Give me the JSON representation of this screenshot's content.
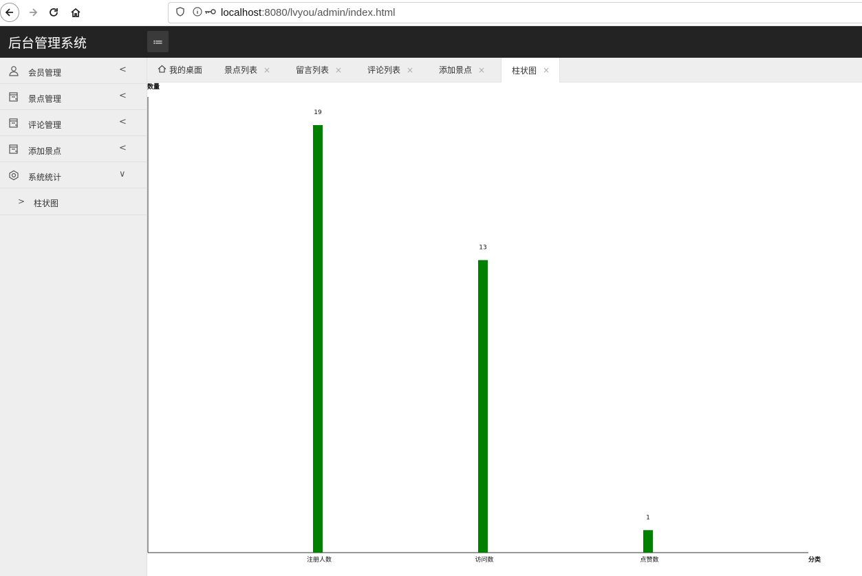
{
  "browser": {
    "url_host": "localhost",
    "url_rest": ":8080/lvyou/admin/index.html",
    "icons": [
      "back-icon",
      "forward-icon",
      "reload-icon",
      "home-icon",
      "shield-icon",
      "info-icon",
      "key-icon"
    ]
  },
  "header": {
    "title": "后台管理系统",
    "menu_icon": "≔"
  },
  "sidebar": {
    "items": [
      {
        "label": "会员管理",
        "icon": "user-icon",
        "arrow": "<"
      },
      {
        "label": "景点管理",
        "icon": "document-icon",
        "arrow": "<"
      },
      {
        "label": "评论管理",
        "icon": "document-icon",
        "arrow": "<"
      },
      {
        "label": "添加景点",
        "icon": "document-icon",
        "arrow": "<"
      },
      {
        "label": "系统统计",
        "icon": "stats-icon",
        "arrow": "∨"
      }
    ],
    "sub_items": [
      {
        "label": "柱状图",
        "arrow": ">"
      }
    ]
  },
  "tabs": [
    {
      "label": "我的桌面",
      "closable": false
    },
    {
      "label": "景点列表",
      "closable": true
    },
    {
      "label": "留言列表",
      "closable": true
    },
    {
      "label": "评论列表",
      "closable": true
    },
    {
      "label": "添加景点",
      "closable": true
    },
    {
      "label": "柱状图",
      "closable": true,
      "active": true
    }
  ],
  "tab_close_glyph": "×",
  "chart_data": {
    "type": "bar",
    "categories": [
      "注册人数",
      "访问数",
      "点赞数"
    ],
    "values": [
      19,
      13,
      1
    ],
    "ylabel": "数量",
    "xlabel": "分类",
    "ylim": [
      0,
      20
    ],
    "bar_color": "#008000",
    "grid": false,
    "legend": "none"
  }
}
